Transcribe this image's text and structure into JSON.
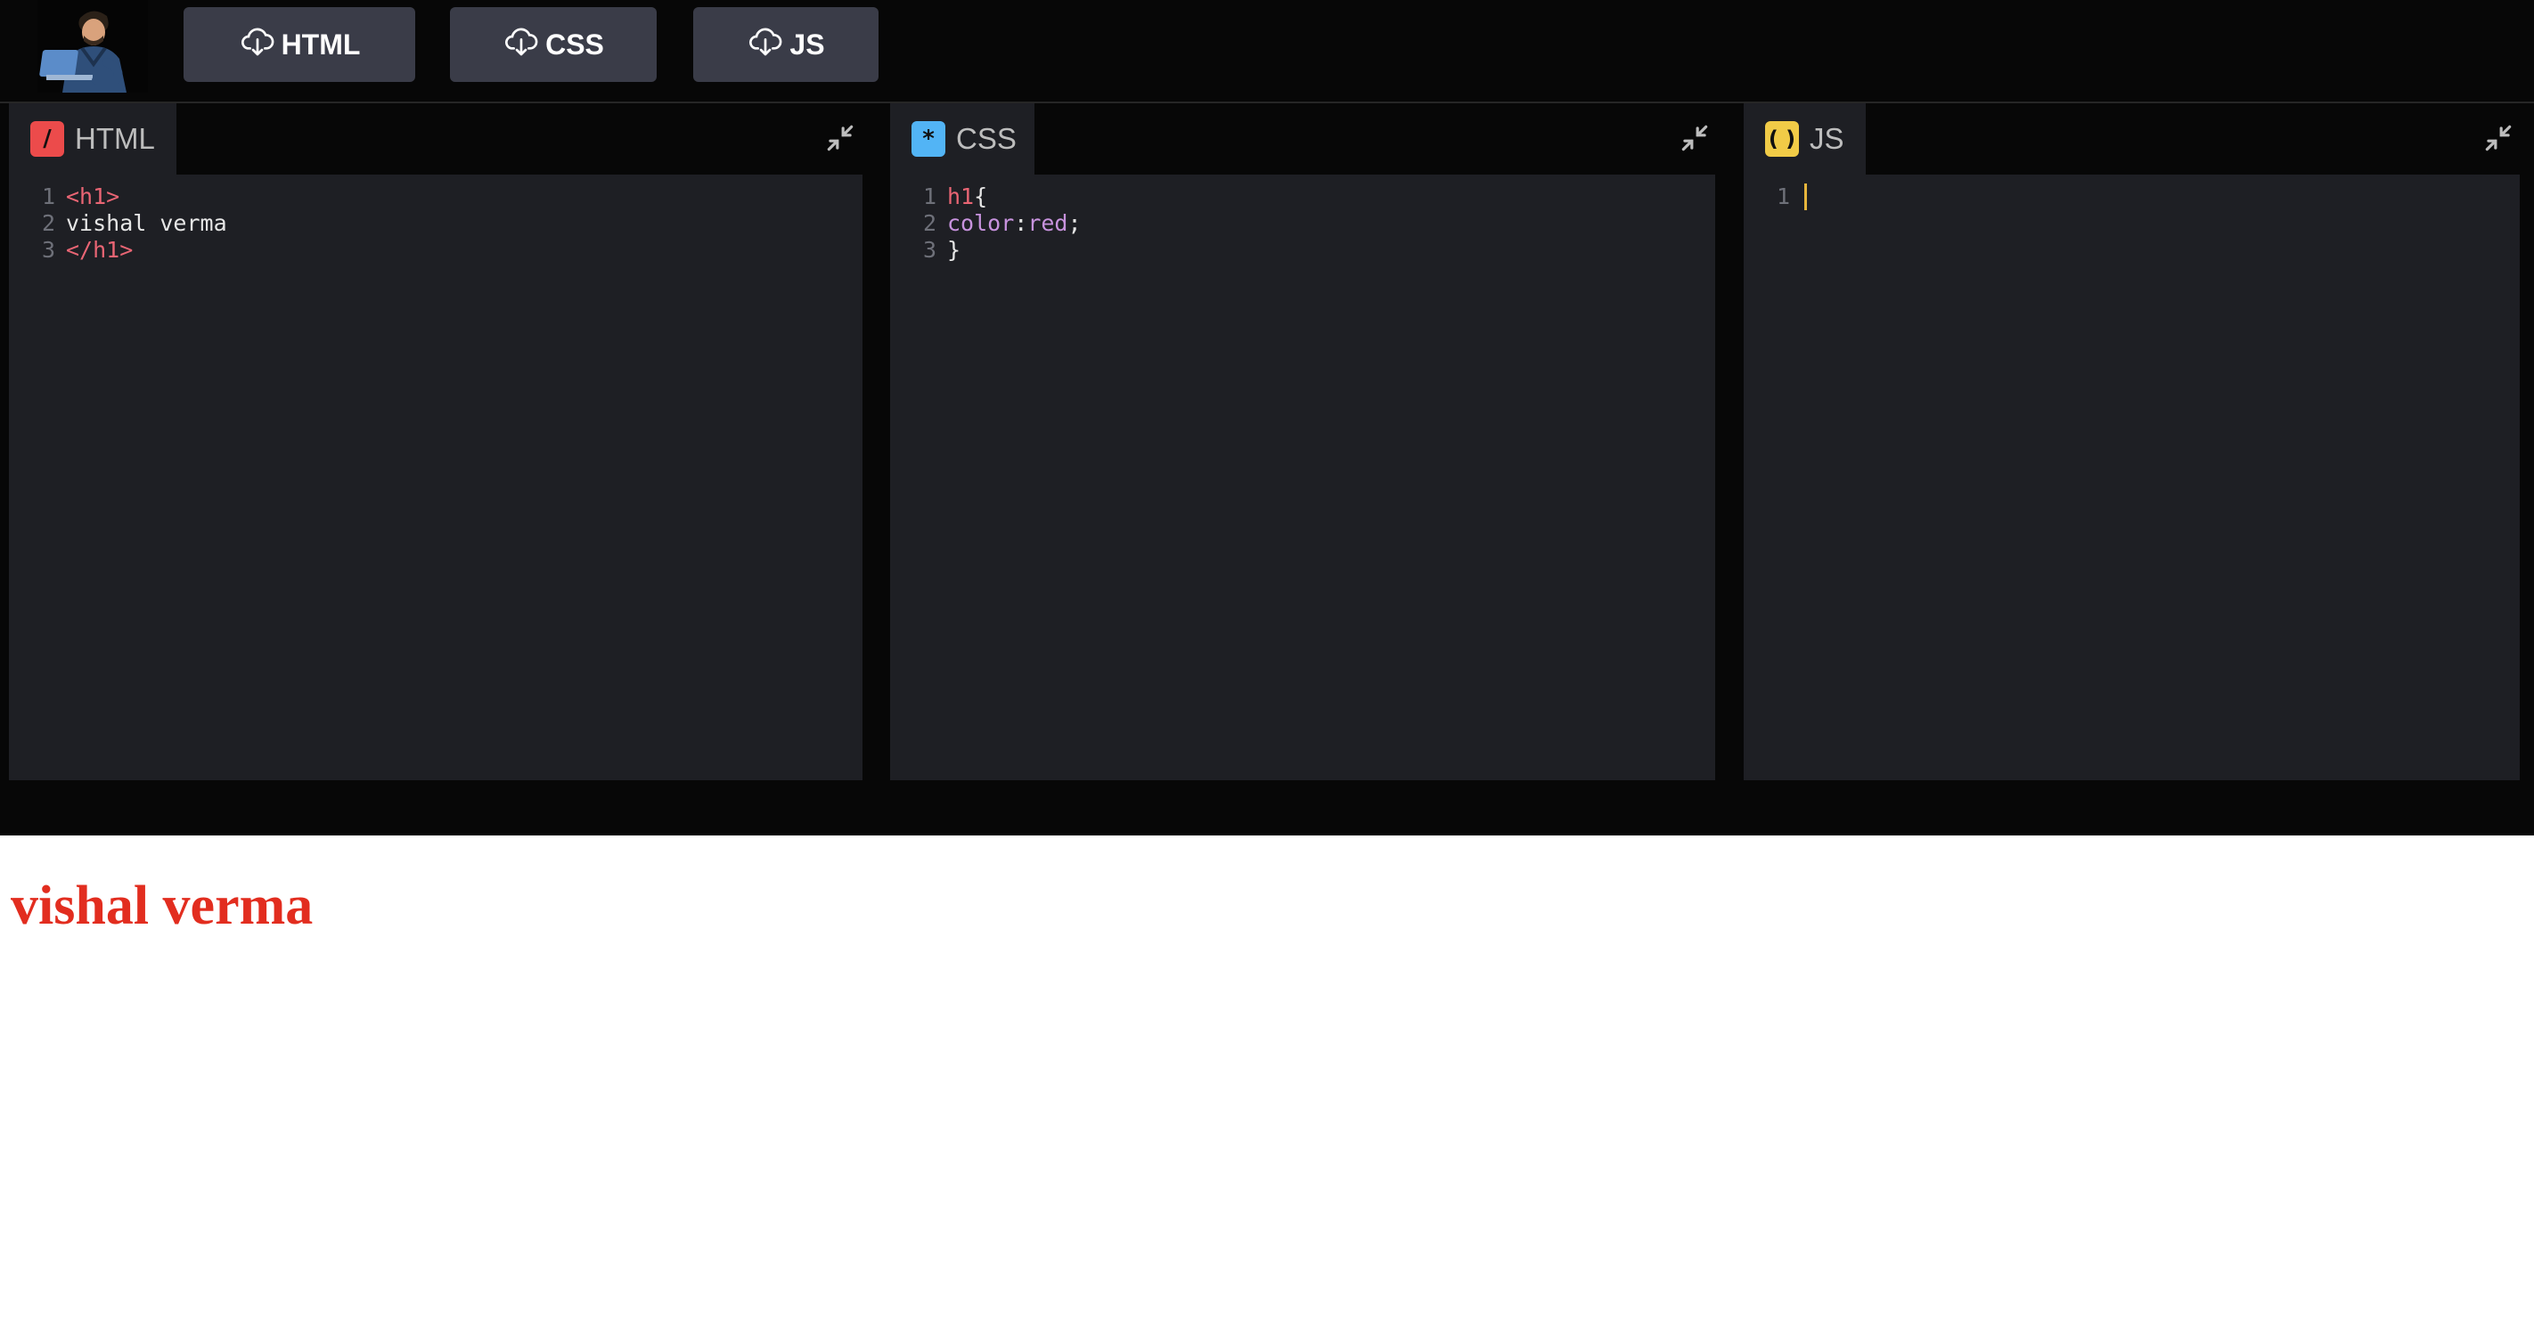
{
  "toolbar": {
    "buttons": [
      {
        "label": "HTML",
        "icon": "cloud-download-icon"
      },
      {
        "label": "CSS",
        "icon": "cloud-download-icon"
      },
      {
        "label": "JS",
        "icon": "cloud-download-icon"
      }
    ]
  },
  "panels": {
    "html": {
      "tab_label": "HTML",
      "icon_glyph": "/",
      "icon_color": "#ec4b4b",
      "lines": [
        {
          "n": "1",
          "text": "<h1>"
        },
        {
          "n": "2",
          "text": "vishal verma"
        },
        {
          "n": "3",
          "text": "</h1>"
        }
      ]
    },
    "css": {
      "tab_label": "CSS",
      "icon_glyph": "*",
      "icon_color": "#52b4f5",
      "lines": [
        {
          "n": "1",
          "sel": "h1",
          "brace": "{"
        },
        {
          "n": "2",
          "prop": "color",
          "colon": ":",
          "value": "red",
          "semi": ";"
        },
        {
          "n": "3",
          "text": "}"
        }
      ]
    },
    "js": {
      "tab_label": "JS",
      "icon_glyph": "( )",
      "icon_color": "#f1cb47",
      "lines": [
        {
          "n": "1"
        }
      ]
    }
  },
  "preview": {
    "heading": "vishal verma",
    "heading_color": "#e22d1f"
  }
}
